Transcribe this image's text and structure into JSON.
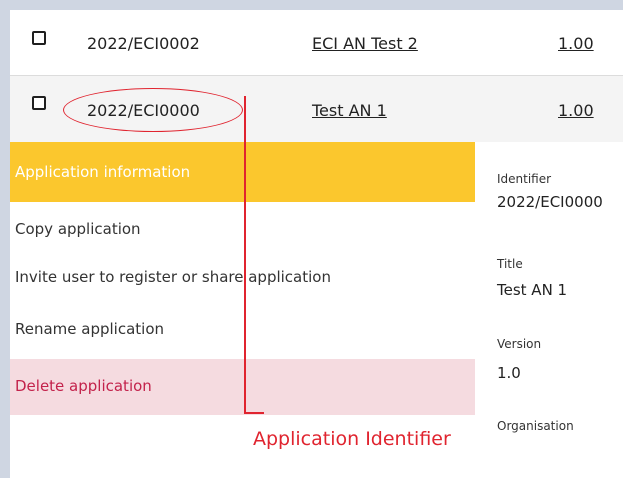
{
  "table": {
    "rows": [
      {
        "identifier": "2022/ECI0002",
        "title": "ECI AN Test 2",
        "version": "1.00"
      },
      {
        "identifier": "2022/ECI0000",
        "title": "Test AN 1",
        "version": "1.00"
      }
    ]
  },
  "menu": {
    "header": "Application information",
    "items": [
      {
        "label": "Copy application"
      },
      {
        "label": "Invite user to register or share application"
      },
      {
        "label": "Rename application"
      },
      {
        "label": "Delete application"
      }
    ]
  },
  "details": {
    "identifier_label": "Identifier",
    "identifier_value": "2022/ECI0000",
    "title_label": "Title",
    "title_value": "Test AN 1",
    "version_label": "Version",
    "version_value": "1.0",
    "organisation_label": "Organisation"
  },
  "annotation": {
    "label": "Application Identifier"
  },
  "colors": {
    "accent": "#fbc72d",
    "danger": "#c3224b",
    "annotation": "#e0242f"
  }
}
